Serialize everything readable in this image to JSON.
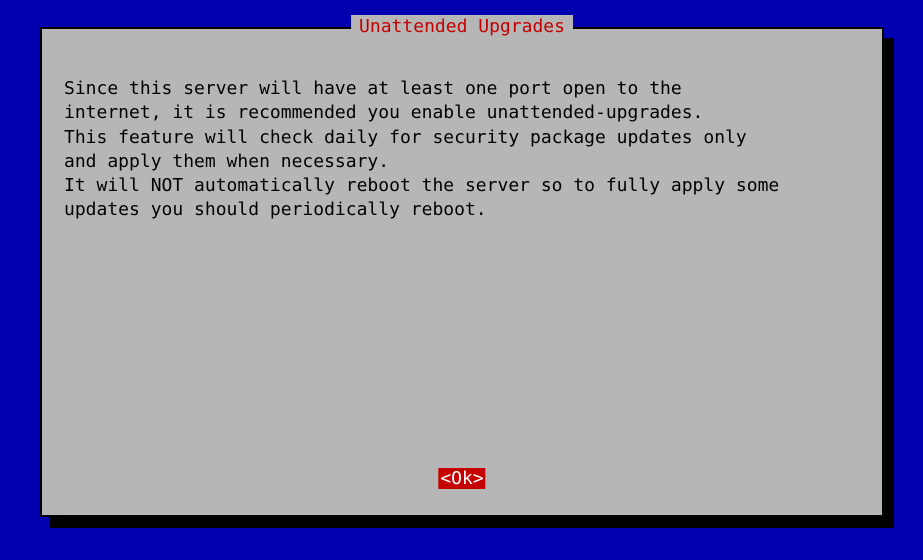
{
  "dialog": {
    "title": " Unattended Upgrades ",
    "body": "Since this server will have at least one port open to the\ninternet, it is recommended you enable unattended-upgrades.\nThis feature will check daily for security package updates only\nand apply them when necessary.\nIt will NOT automatically reboot the server so to fully apply some\nupdates you should periodically reboot.",
    "ok_label": "<Ok>"
  }
}
